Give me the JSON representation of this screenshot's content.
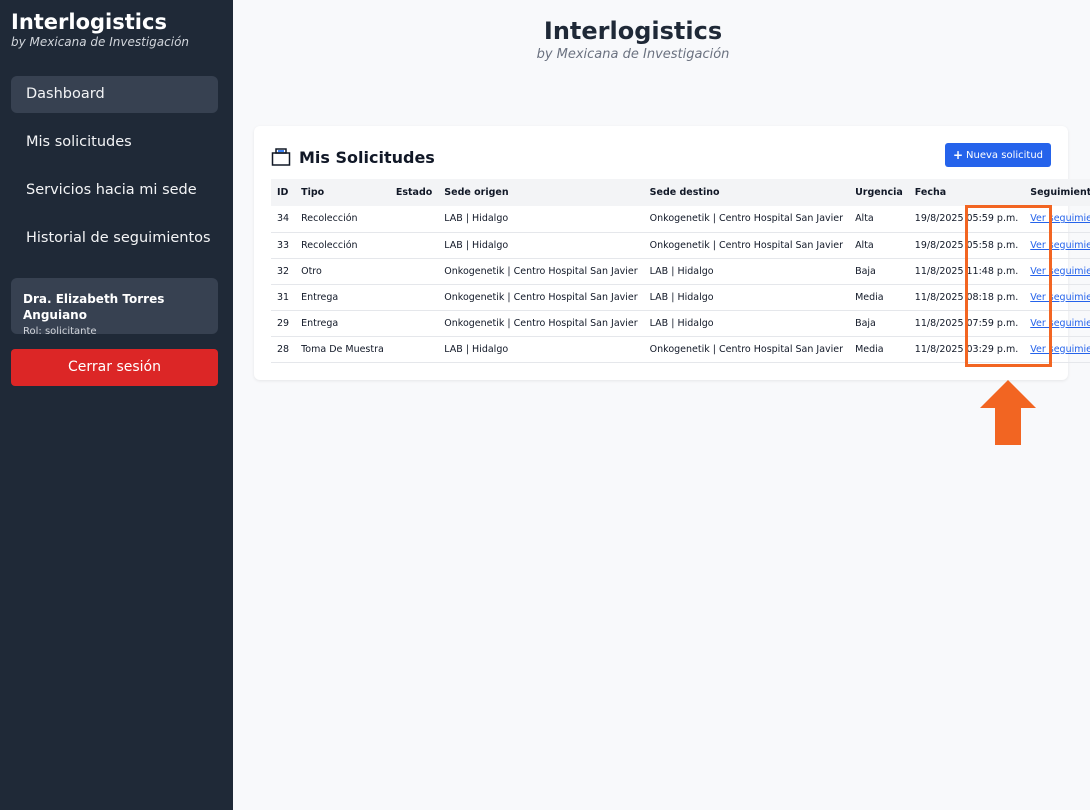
{
  "sidebar": {
    "brand_title": "Interlogistics",
    "brand_sub": "by Mexicana de Investigación",
    "items": [
      {
        "label": "Dashboard"
      },
      {
        "label": "Mis solicitudes"
      },
      {
        "label": "Servicios hacia mi sede"
      },
      {
        "label": "Historial de seguimientos"
      }
    ],
    "user_name": "Dra. Elizabeth Torres Anguiano",
    "user_role": "Rol: solicitante",
    "logout_label": "Cerrar sesión"
  },
  "header": {
    "title": "Interlogistics",
    "subtitle": "by Mexicana de Investigación"
  },
  "card": {
    "icon": "box-icon",
    "title": "Mis Solicitudes",
    "new_button_icon": "plus-icon",
    "new_button_label": "Nueva solicitud"
  },
  "table": {
    "columns": [
      "ID",
      "Tipo",
      "Estado",
      "Sede origen",
      "Sede destino",
      "Urgencia",
      "Fecha",
      "Seguimiento"
    ],
    "rows": [
      {
        "id": "34",
        "tipo": "Recolección",
        "estado": "",
        "origen": "LAB | Hidalgo",
        "destino": "Onkogenetik | Centro Hospital San Javier",
        "urgencia": "Alta",
        "fecha": "19/8/2025 05:59 p.m.",
        "seguimiento": "Ver seguimiento"
      },
      {
        "id": "33",
        "tipo": "Recolección",
        "estado": "",
        "origen": "LAB | Hidalgo",
        "destino": "Onkogenetik | Centro Hospital San Javier",
        "urgencia": "Alta",
        "fecha": "19/8/2025 05:58 p.m.",
        "seguimiento": "Ver seguimiento"
      },
      {
        "id": "32",
        "tipo": "Otro",
        "estado": "",
        "origen": "Onkogenetik | Centro Hospital San Javier",
        "destino": "LAB | Hidalgo",
        "urgencia": "Baja",
        "fecha": "11/8/2025 11:48 p.m.",
        "seguimiento": "Ver seguimiento"
      },
      {
        "id": "31",
        "tipo": "Entrega",
        "estado": "",
        "origen": "Onkogenetik | Centro Hospital San Javier",
        "destino": "LAB | Hidalgo",
        "urgencia": "Media",
        "fecha": "11/8/2025 08:18 p.m.",
        "seguimiento": "Ver seguimiento"
      },
      {
        "id": "29",
        "tipo": "Entrega",
        "estado": "",
        "origen": "Onkogenetik | Centro Hospital San Javier",
        "destino": "LAB | Hidalgo",
        "urgencia": "Baja",
        "fecha": "11/8/2025 07:59 p.m.",
        "seguimiento": "Ver seguimiento"
      },
      {
        "id": "28",
        "tipo": "Toma De Muestra",
        "estado": "",
        "origen": "LAB | Hidalgo",
        "destino": "Onkogenetik | Centro Hospital San Javier",
        "urgencia": "Media",
        "fecha": "11/8/2025 03:29 p.m.",
        "seguimiento": "Ver seguimiento"
      }
    ]
  },
  "annotation": {
    "highlight_color": "#f26522",
    "arrow_icon": "up-arrow-icon"
  },
  "colors": {
    "sidebar_bg": "#1f2937",
    "accent": "#2563eb",
    "logout": "#dc2626"
  }
}
